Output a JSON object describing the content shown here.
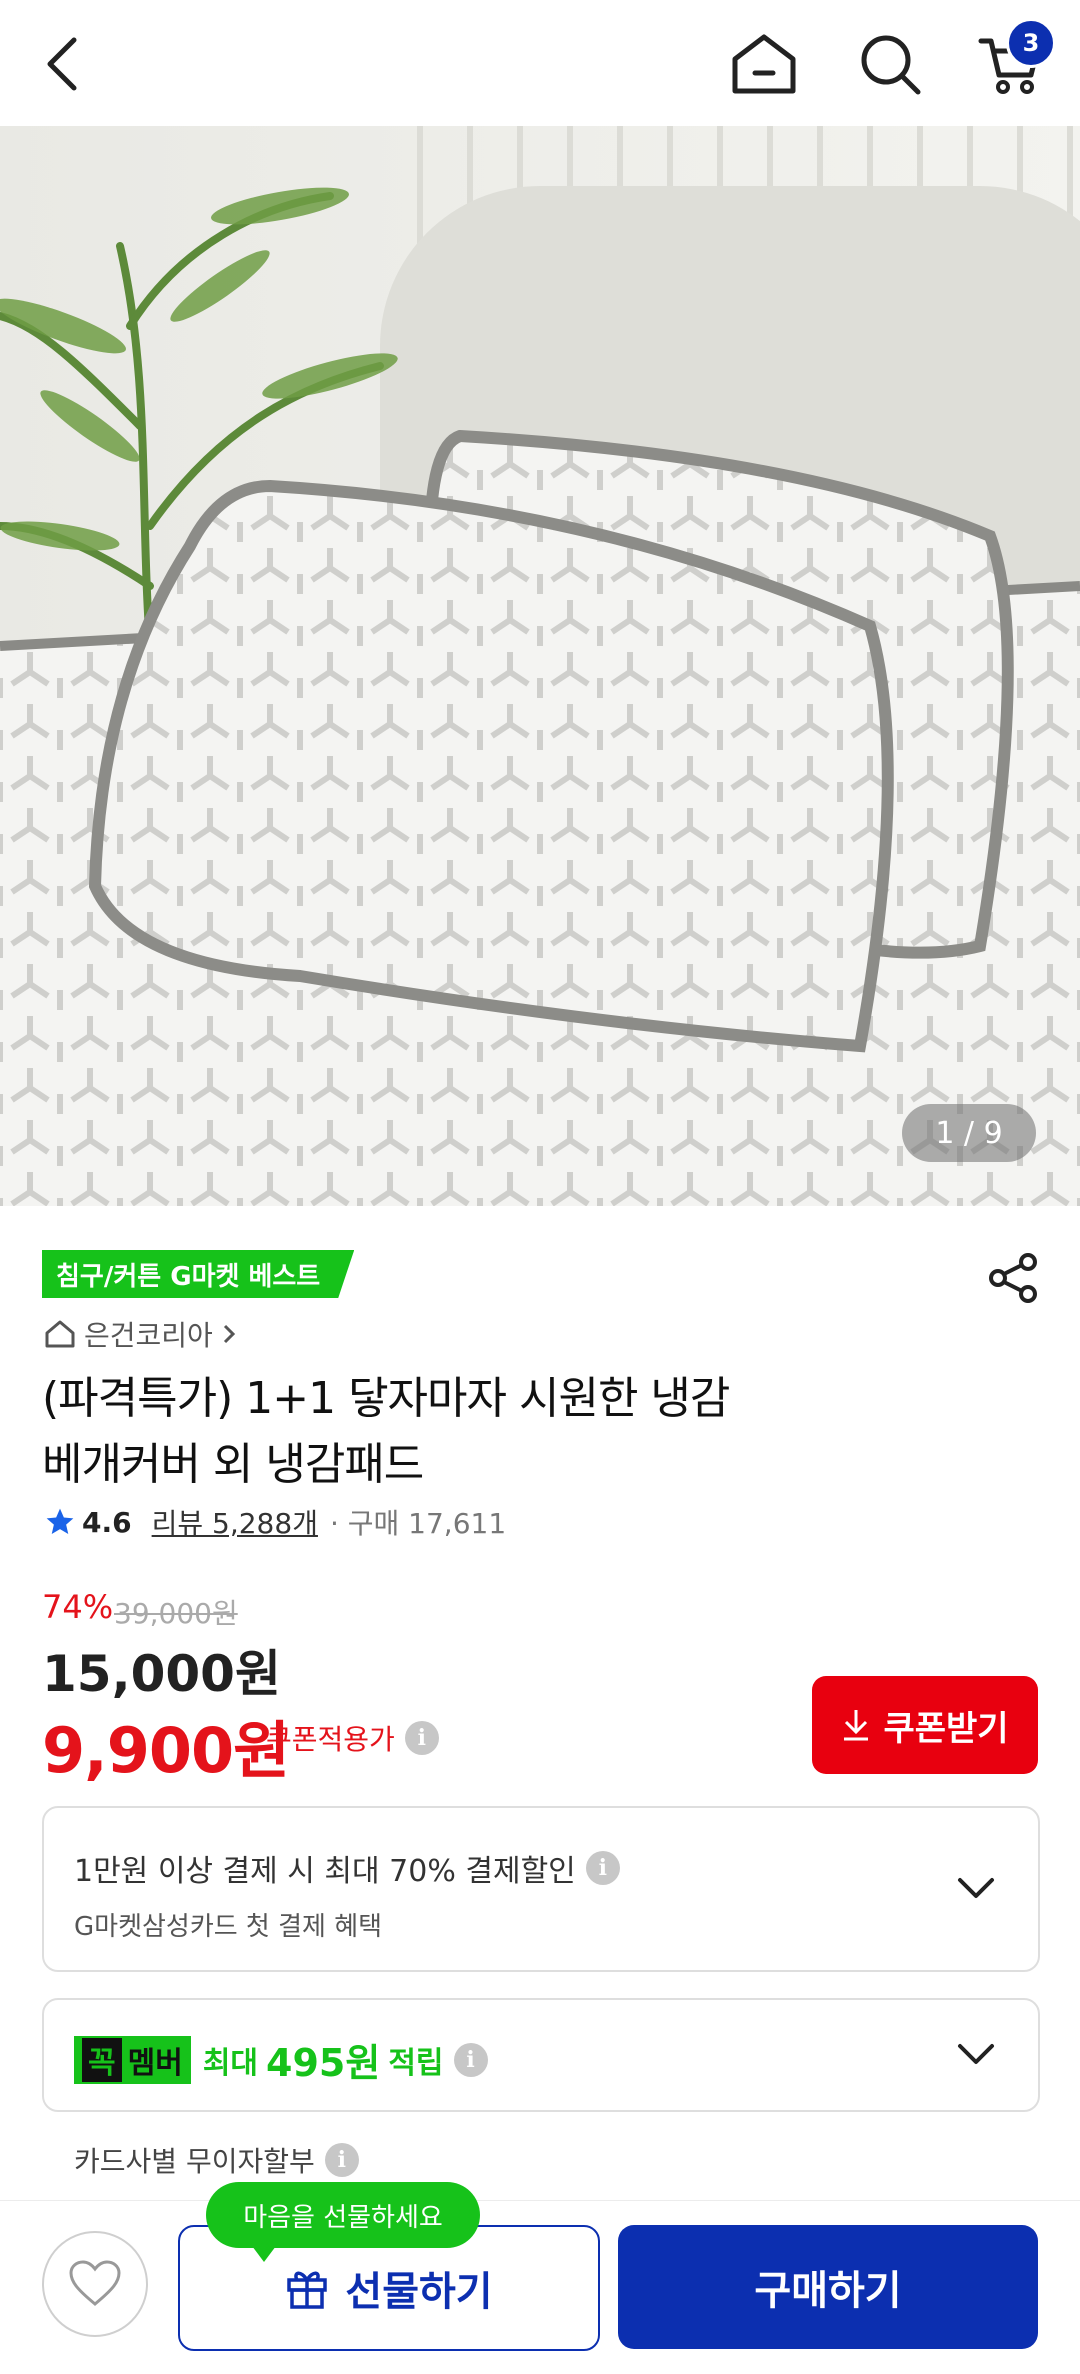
{
  "header": {
    "cart_count": "3"
  },
  "hero": {
    "counter": "1 / 9"
  },
  "product": {
    "best_tag": "침구/커튼 G마켓 베스트",
    "seller": "은건코리아",
    "title_line1": "(파격특가) 1+1 닿자마자 시원한 냉감",
    "title_line2": "베개커버 외 냉감패드",
    "rating": "4.6",
    "reviews": "리뷰 5,288개",
    "purchases": "· 구매 17,611"
  },
  "price": {
    "discount": "74%",
    "original": "39,000원",
    "sale": "15,000원",
    "coupon_price": "9,900원",
    "coupon_label": "쿠폰적용가",
    "coupon_button": "쿠폰받기"
  },
  "benefits": {
    "card_line1": "1만원 이상 결제 시 최대  70% 결제할인",
    "card_line2": "G마켓삼성카드 첫 결제 혜택",
    "member_badge_k": "꼭",
    "member_badge": "멤버",
    "member_text": "최대",
    "member_points": "495원",
    "member_suffix": "적립",
    "installment": "카드사별 무이자할부"
  },
  "bottom": {
    "tooltip": "마음을 선물하세요",
    "gift": "선물하기",
    "buy": "구매하기"
  },
  "colors": {
    "brand_blue": "#0c2fb0",
    "sale_red": "#e4131b",
    "gmarket_green": "#16c21a"
  }
}
